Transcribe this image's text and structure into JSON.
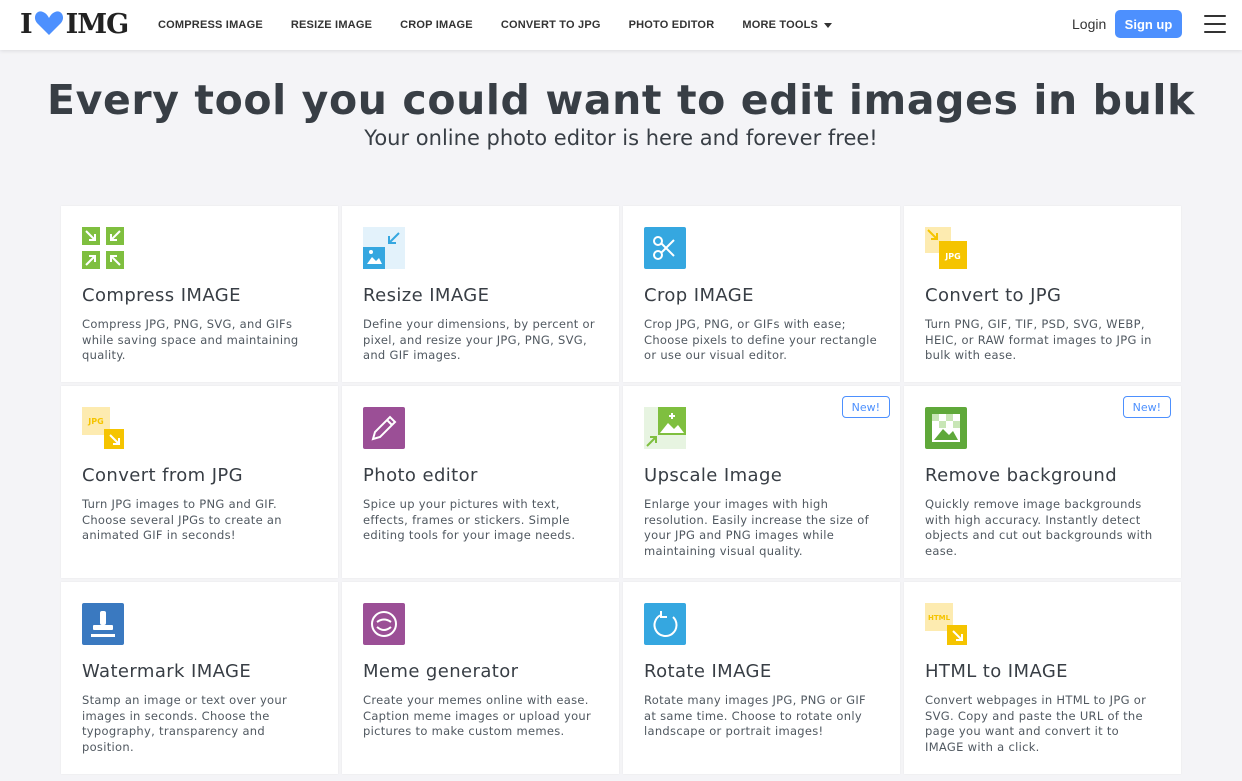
{
  "brand": {
    "name_left": "I",
    "name_right": "IMG",
    "accent": "#4d90fe"
  },
  "nav": {
    "items": [
      "Compress IMAGE",
      "Resize IMAGE",
      "Crop IMAGE",
      "Convert to JPG",
      "Photo Editor"
    ],
    "more": "More tools",
    "login": "Login",
    "signup": "Sign up"
  },
  "hero": {
    "title": "Every tool you could want to edit images in bulk",
    "subtitle": "Your online photo editor is here and forever free!"
  },
  "tools": [
    {
      "title": "Compress IMAGE",
      "icon": "compress-icon",
      "desc": "Compress JPG, PNG, SVG, and GIFs while saving space and maintaining quality."
    },
    {
      "title": "Resize IMAGE",
      "icon": "resize-icon",
      "desc": "Define your dimensions, by percent or pixel, and resize your JPG, PNG, SVG, and GIF images."
    },
    {
      "title": "Crop IMAGE",
      "icon": "crop-icon",
      "desc": "Crop JPG, PNG, or GIFs with ease; Choose pixels to define your rectangle or use our visual editor."
    },
    {
      "title": "Convert to JPG",
      "icon": "convert-to-jpg-icon",
      "desc": "Turn PNG, GIF, TIF, PSD, SVG, WEBP, HEIC, or RAW format images to JPG in bulk with ease."
    },
    {
      "title": "Convert from JPG",
      "icon": "convert-from-jpg-icon",
      "desc": "Turn JPG images to PNG and GIF. Choose several JPGs to create an animated GIF in seconds!"
    },
    {
      "title": "Photo editor",
      "icon": "photo-editor-icon",
      "desc": "Spice up your pictures with text, effects, frames or stickers. Simple editing tools for your image needs."
    },
    {
      "title": "Upscale Image",
      "icon": "upscale-icon",
      "badge": "New!",
      "desc": "Enlarge your images with high resolution. Easily increase the size of your JPG and PNG images while maintaining visual quality."
    },
    {
      "title": "Remove background",
      "icon": "remove-background-icon",
      "badge": "New!",
      "desc": "Quickly remove image backgrounds with high accuracy. Instantly detect objects and cut out backgrounds with ease."
    },
    {
      "title": "Watermark IMAGE",
      "icon": "watermark-icon",
      "desc": "Stamp an image or text over your images in seconds. Choose the typography, transparency and position."
    },
    {
      "title": "Meme generator",
      "icon": "meme-icon",
      "desc": "Create your memes online with ease. Caption meme images or upload your pictures to make custom memes."
    },
    {
      "title": "Rotate IMAGE",
      "icon": "rotate-icon",
      "desc": "Rotate many images JPG, PNG or GIF at same time. Choose to rotate only landscape or portrait images!"
    },
    {
      "title": "HTML to IMAGE",
      "icon": "html-to-image-icon",
      "desc": "Convert webpages in HTML to JPG or SVG. Copy and paste the URL of the page you want and convert it to IMAGE with a click."
    }
  ]
}
